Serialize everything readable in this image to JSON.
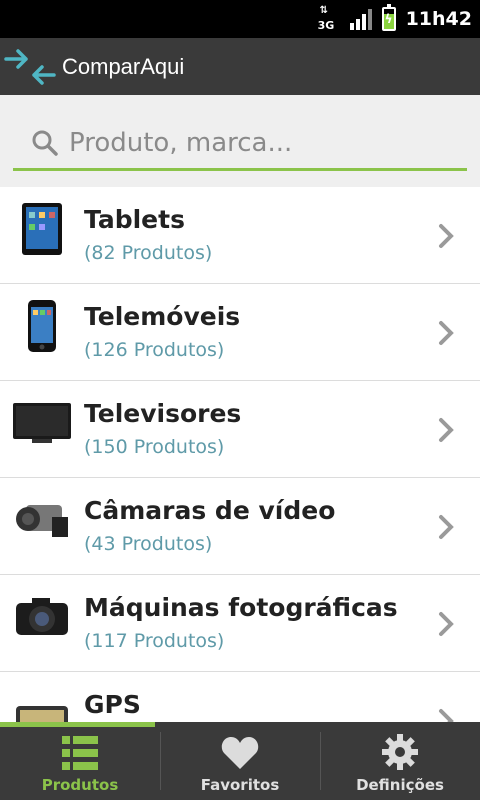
{
  "status_bar": {
    "network": "3G",
    "time": "11h42",
    "battery_level": 0.75
  },
  "app": {
    "title": "ComparAqui",
    "logo_icon": "compare-arrows-icon",
    "accent": "#8bc34a"
  },
  "search": {
    "placeholder": "Produto, marca...",
    "value": ""
  },
  "categories": [
    {
      "name": "Tablets",
      "count": "(82 Produtos)",
      "icon": "tablet-icon"
    },
    {
      "name": "Telemóveis",
      "count": "(126 Produtos)",
      "icon": "phone-icon"
    },
    {
      "name": "Televisores",
      "count": "(150 Produtos)",
      "icon": "tv-icon"
    },
    {
      "name": "Câmaras de vídeo",
      "count": "(43 Produtos)",
      "icon": "camcorder-icon"
    },
    {
      "name": "Máquinas fotográficas",
      "count": "(117 Produtos)",
      "icon": "camera-icon"
    },
    {
      "name": "GPS",
      "count": "",
      "icon": "gps-icon"
    }
  ],
  "tabs": [
    {
      "label": "Produtos",
      "icon": "list-icon",
      "active": true
    },
    {
      "label": "Favoritos",
      "icon": "heart-icon",
      "active": false
    },
    {
      "label": "Definições",
      "icon": "gear-icon",
      "active": false
    }
  ]
}
